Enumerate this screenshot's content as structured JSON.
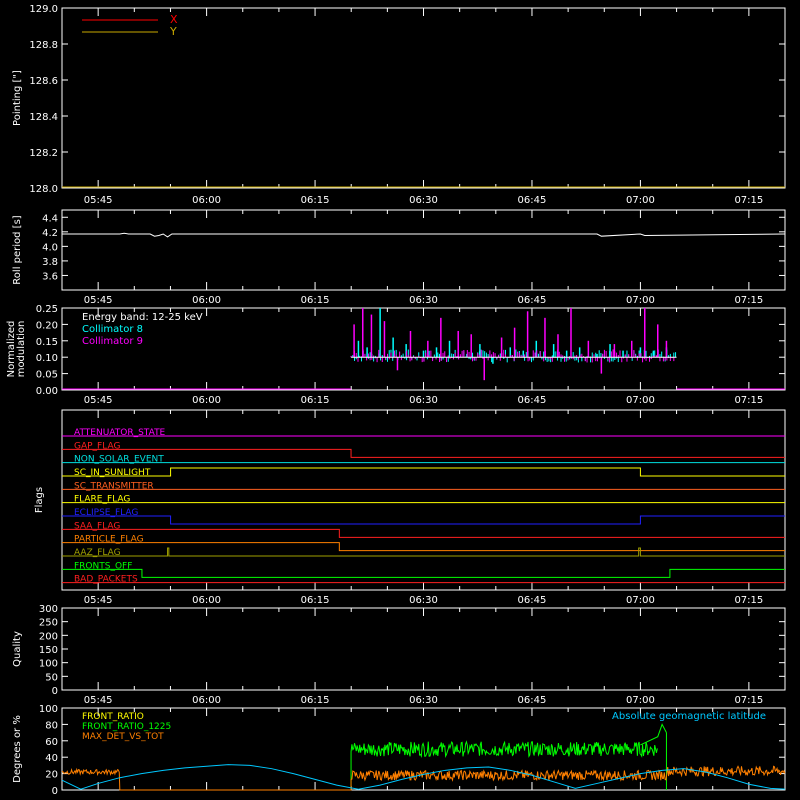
{
  "time_axis": {
    "tick_labels": [
      "05:45",
      "06:00",
      "06:15",
      "06:30",
      "06:45",
      "07:00",
      "07:15"
    ],
    "tick_hours": [
      5.75,
      6.0,
      6.25,
      6.5,
      6.75,
      7.0,
      7.25
    ],
    "range_hours": [
      5.6667,
      7.3333
    ]
  },
  "colors": {
    "background": "#000000",
    "axes": "#ffffff",
    "x_series": "#ff0000",
    "y_series": "#c8a800",
    "collimator8": "#00ffff",
    "collimator9": "#ff00ff",
    "front_ratio": "#ffff00",
    "front_ratio_1225": "#00ff00",
    "max_det": "#ff8000",
    "geomag": "#00c8ff"
  },
  "chart_data": [
    {
      "type": "line",
      "id": "pointing",
      "ylabel": "Pointing [\"]",
      "ylim": [
        128.0,
        129.0
      ],
      "yticks": [
        128.0,
        128.2,
        128.4,
        128.6,
        128.8,
        129.0
      ],
      "ytick_labels": [
        "128.0",
        "128.2",
        "128.4",
        "128.6",
        "128.8",
        "129.0"
      ],
      "legend": [
        {
          "label": "X",
          "color": "#ff0000"
        },
        {
          "label": "Y",
          "color": "#c8a800"
        }
      ],
      "series": [
        {
          "name": "X",
          "x": [
            5.6667,
            7.3333
          ],
          "y": [
            128.0,
            128.0
          ]
        },
        {
          "name": "Y",
          "x": [
            5.6667,
            7.3333
          ],
          "y": [
            128.0,
            128.0
          ]
        }
      ]
    },
    {
      "type": "line",
      "id": "roll",
      "ylabel": "Roll period [s]",
      "ylim": [
        3.4,
        4.5
      ],
      "yticks": [
        3.6,
        3.8,
        4.0,
        4.2,
        4.4
      ],
      "ytick_labels": [
        "3.6",
        "3.8",
        "4.0",
        "4.2",
        "4.4"
      ],
      "series": [
        {
          "name": "Roll period",
          "x": [
            5.6667,
            5.8,
            5.81,
            5.82,
            5.87,
            5.88,
            5.89,
            5.9,
            5.91,
            5.92,
            6.5,
            6.9,
            6.91,
            7.0,
            7.01,
            7.3333
          ],
          "y": [
            4.17,
            4.17,
            4.18,
            4.17,
            4.17,
            4.14,
            4.15,
            4.17,
            4.13,
            4.17,
            4.17,
            4.17,
            4.14,
            4.17,
            4.15,
            4.17
          ]
        }
      ]
    },
    {
      "type": "line",
      "id": "modulation",
      "ylabel": "Normalized modulation",
      "ylim": [
        0.0,
        0.25
      ],
      "yticks": [
        0.0,
        0.05,
        0.1,
        0.15,
        0.2,
        0.25
      ],
      "ytick_labels": [
        "0.00",
        "0.05",
        "0.10",
        "0.15",
        "0.20",
        "0.25"
      ],
      "legend": [
        {
          "label": "Energy band: 12-25 keV",
          "color": "#ffffff"
        },
        {
          "label": "Collimator 8",
          "color": "#00ffff"
        },
        {
          "label": "Collimator 9",
          "color": "#ff00ff"
        }
      ],
      "active_range": [
        6.333,
        7.0833
      ],
      "series": [
        {
          "name": "Collimator 8",
          "baseline": 0.1,
          "x": [
            6.35,
            6.37,
            6.4,
            6.43,
            6.46,
            6.5,
            6.53,
            6.56,
            6.6,
            6.63,
            6.66,
            6.7,
            6.73,
            6.76,
            6.8,
            6.83,
            6.86,
            6.9,
            6.93,
            6.96,
            7.0,
            7.03,
            7.06
          ],
          "y": [
            0.15,
            0.13,
            0.25,
            0.16,
            0.14,
            0.12,
            0.13,
            0.15,
            0.11,
            0.14,
            0.08,
            0.13,
            0.12,
            0.15,
            0.14,
            0.12,
            0.13,
            0.11,
            0.14,
            0.12,
            0.13,
            0.12,
            0.13
          ]
        },
        {
          "name": "Collimator 9",
          "baseline": 0.1,
          "x": [
            6.34,
            6.36,
            6.38,
            6.41,
            6.44,
            6.47,
            6.51,
            6.54,
            6.58,
            6.61,
            6.64,
            6.68,
            6.71,
            6.74,
            6.78,
            6.81,
            6.84,
            6.88,
            6.91,
            6.94,
            6.98,
            7.01,
            7.04,
            7.06
          ],
          "y": [
            0.2,
            0.25,
            0.23,
            0.21,
            0.06,
            0.18,
            0.15,
            0.22,
            0.18,
            0.17,
            0.03,
            0.16,
            0.19,
            0.24,
            0.22,
            0.17,
            0.25,
            0.15,
            0.05,
            0.14,
            0.15,
            0.25,
            0.2,
            0.15
          ]
        }
      ]
    },
    {
      "type": "step",
      "id": "flags",
      "ylabel": "Flags",
      "flags": [
        {
          "label": "ATTENUATOR_STATE",
          "color": "#ff00ff",
          "steps": [
            [
              5.6667,
              0
            ],
            [
              7.3333,
              0
            ]
          ]
        },
        {
          "label": "GAP_FLAG",
          "color": "#ff2020",
          "steps": [
            [
              5.6667,
              1
            ],
            [
              6.333,
              0
            ],
            [
              7.3333,
              0
            ]
          ]
        },
        {
          "label": "NON_SOLAR_EVENT",
          "color": "#00e0e0",
          "steps": [
            [
              5.6667,
              0
            ],
            [
              7.3333,
              0
            ]
          ]
        },
        {
          "label": "SC_IN_SUNLIGHT",
          "color": "#ffff00",
          "steps": [
            [
              5.6667,
              0
            ],
            [
              5.917,
              1
            ],
            [
              7.0,
              0
            ],
            [
              7.3333,
              0
            ]
          ]
        },
        {
          "label": "SC_TRANSMITTER",
          "color": "#ff6020",
          "steps": [
            [
              5.6667,
              0
            ],
            [
              7.3333,
              0
            ]
          ]
        },
        {
          "label": "FLARE_FLAG",
          "color": "#ffff00",
          "steps": [
            [
              5.6667,
              0
            ],
            [
              7.3333,
              0
            ]
          ]
        },
        {
          "label": "ECLIPSE_FLAG",
          "color": "#2020ff",
          "steps": [
            [
              5.6667,
              1
            ],
            [
              5.917,
              0
            ],
            [
              7.0,
              1
            ],
            [
              7.3333,
              1
            ]
          ]
        },
        {
          "label": "SAA_FLAG",
          "color": "#ff2020",
          "steps": [
            [
              5.6667,
              1
            ],
            [
              6.306,
              0
            ],
            [
              7.3333,
              0
            ]
          ]
        },
        {
          "label": "PARTICLE_FLAG",
          "color": "#ff8000",
          "steps": [
            [
              5.6667,
              1
            ],
            [
              6.306,
              0
            ],
            [
              7.3333,
              0
            ]
          ]
        },
        {
          "label": "AAZ_FLAG",
          "color": "#a0a000",
          "steps": [
            [
              5.6667,
              0
            ],
            [
              5.91,
              1
            ],
            [
              5.913,
              0
            ],
            [
              6.996,
              1
            ],
            [
              7.0,
              0
            ],
            [
              7.3333,
              0
            ]
          ]
        },
        {
          "label": "FRONTS_OFF",
          "color": "#00ff00",
          "steps": [
            [
              5.6667,
              0
            ],
            [
              5.85,
              0
            ],
            [
              5.851,
              -1
            ],
            [
              7.067,
              -1
            ],
            [
              7.068,
              0
            ],
            [
              7.3333,
              0
            ]
          ]
        },
        {
          "label": "BAD_PACKETS",
          "color": "#ff2020",
          "steps": [
            [
              5.6667,
              0
            ],
            [
              7.3333,
              0
            ]
          ]
        }
      ]
    },
    {
      "type": "line",
      "id": "quality",
      "ylabel": "Quality",
      "ylim": [
        0,
        300
      ],
      "yticks": [
        0,
        50,
        100,
        150,
        200,
        250,
        300
      ],
      "ytick_labels": [
        "0",
        "50",
        "100",
        "150",
        "200",
        "250",
        "300"
      ],
      "series": []
    },
    {
      "type": "line",
      "id": "degrees",
      "ylabel": "Degrees or %",
      "ylim": [
        0,
        100
      ],
      "yticks": [
        0,
        20,
        40,
        60,
        80,
        100
      ],
      "ytick_labels": [
        "0",
        "20",
        "40",
        "60",
        "80",
        "100"
      ],
      "legend": [
        {
          "label": "FRONT_RATIO",
          "color": "#ffff00"
        },
        {
          "label": "FRONT_RATIO_1225",
          "color": "#00ff00"
        },
        {
          "label": "MAX_DET_VS_TOT",
          "color": "#ff8000"
        },
        {
          "label": "Absolute geomagnetic latitude",
          "color": "#00c8ff"
        }
      ],
      "series": [
        {
          "name": "FRONT_RATIO",
          "x": [
            6.333,
            7.06
          ],
          "y": [
            50,
            50
          ],
          "note_only": true
        },
        {
          "name": "FRONT_RATIO_1225",
          "baseline": 50,
          "x": [
            6.333,
            6.4,
            6.5,
            6.6,
            6.7,
            6.8,
            6.9,
            7.0,
            7.04,
            7.05,
            7.06
          ],
          "y": [
            45,
            50,
            52,
            53,
            51,
            52,
            50,
            55,
            65,
            80,
            70
          ]
        },
        {
          "name": "MAX_DET_VS_TOT",
          "x": [
            5.6667,
            5.7,
            5.75,
            5.8,
            6.333,
            6.4,
            6.5,
            6.6,
            6.7,
            6.8,
            6.9,
            7.0,
            7.06,
            7.1,
            7.2,
            7.3333
          ],
          "y": [
            22,
            23,
            22,
            24,
            18,
            20,
            19,
            17,
            20,
            18,
            19,
            17,
            23,
            24,
            22,
            21
          ]
        },
        {
          "name": "Absolute geomagnetic latitude",
          "x": [
            5.6667,
            5.71,
            5.75,
            5.8,
            5.85,
            5.9,
            5.95,
            6.0,
            6.05,
            6.1,
            6.15,
            6.2,
            6.25,
            6.3,
            6.35,
            6.4,
            6.45,
            6.5,
            6.55,
            6.6,
            6.65,
            6.7,
            6.75,
            6.8,
            6.85,
            6.9,
            6.95,
            7.0,
            7.05,
            7.1,
            7.15,
            7.2,
            7.25,
            7.3,
            7.3333
          ],
          "y": [
            12,
            1,
            8,
            15,
            20,
            24,
            27,
            29,
            31,
            30,
            26,
            20,
            13,
            6,
            1,
            6,
            13,
            19,
            24,
            27,
            28,
            24,
            18,
            10,
            2,
            8,
            14,
            20,
            24,
            26,
            22,
            15,
            7,
            2,
            1
          ]
        }
      ]
    }
  ]
}
